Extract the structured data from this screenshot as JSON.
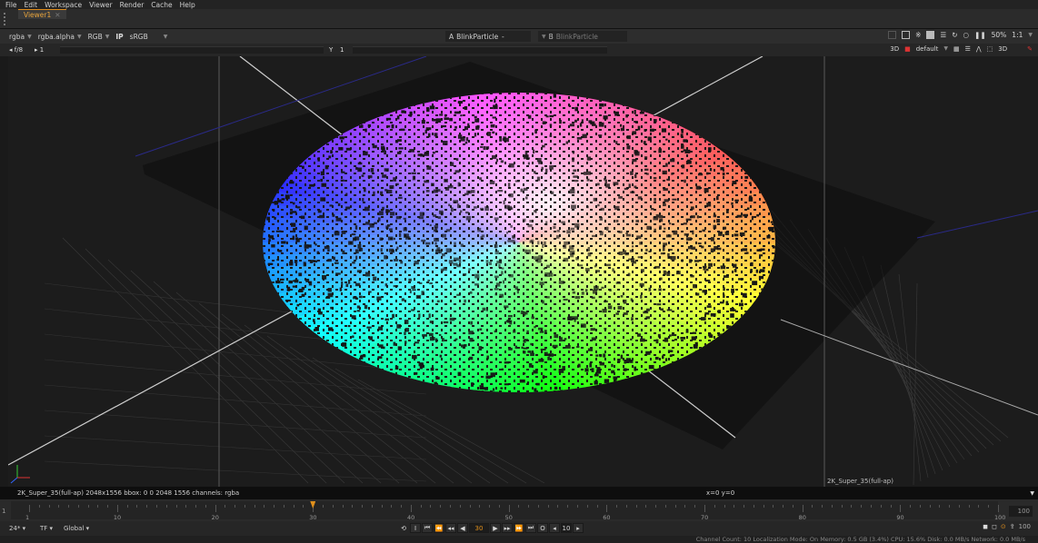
{
  "menubar": {
    "items": [
      "File",
      "Edit",
      "Workspace",
      "Viewer",
      "Render",
      "Cache",
      "Help"
    ]
  },
  "tabs": [
    {
      "label": "Viewer1"
    }
  ],
  "controls": {
    "channels": "rgba",
    "alpha_channel": "rgba.alpha",
    "display_mode": "RGB",
    "ip_label": "IP",
    "lut": "sRGB",
    "input_a_letter": "A",
    "input_a_node": "BlinkParticle",
    "input_a_op": "-",
    "input_b_letter": "B",
    "input_b_node": "BlinkParticle",
    "zoom": "50%",
    "ratio": "1:1",
    "view_mode": "3D",
    "camera": "default",
    "mode_label": "3D"
  },
  "gain": {
    "fstop": "f/8",
    "gain_value": "1",
    "gamma_label": "Y",
    "gamma_value": "1"
  },
  "viewer": {
    "format_label": "2K_Super_35(full-ap)"
  },
  "infobar": {
    "info": "2K_Super_35(full-ap) 2048x1556  bbox: 0 0 2048 1556 channels: rgba",
    "coords": "x=0 y=0"
  },
  "timeline": {
    "start_frame": "1",
    "end_frame": "100",
    "current_frame": 30,
    "tick_labels": [
      "1",
      "10",
      "20",
      "30",
      "40",
      "50",
      "60",
      "70",
      "80",
      "90",
      "100"
    ]
  },
  "playback": {
    "fps": "24*",
    "tf": "TF",
    "range": "Global",
    "current_frame": "30",
    "step": "10",
    "end_frame": "100"
  },
  "status": {
    "text": "Channel Count: 10  Localization Mode: On  Memory: 0.5 GB (3.4%)  CPU: 15.6%  Disk: 0.0 MB/s  Network: 0.0 MB/s"
  }
}
